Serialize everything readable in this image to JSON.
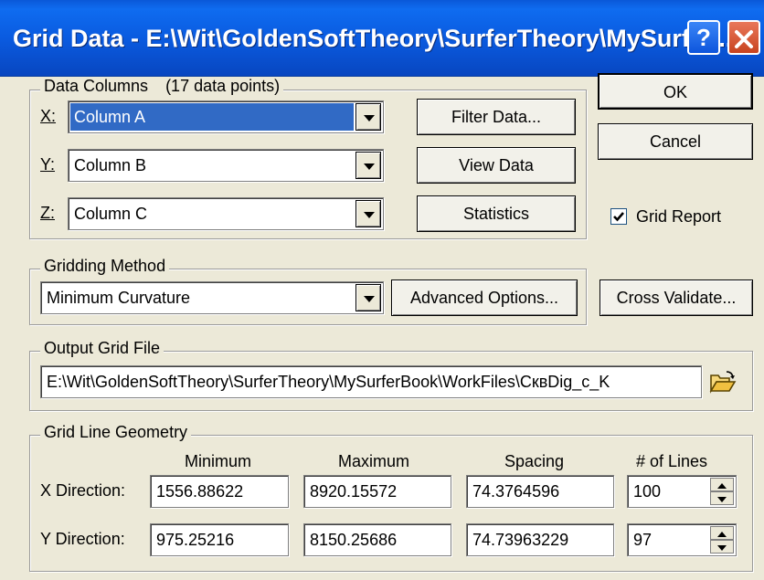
{
  "window": {
    "title": "Grid Data - E:\\Wit\\GoldenSoftTheory\\SurferTheory\\MySurfer...",
    "help_glyph": "?",
    "close_icon": "close-icon"
  },
  "data_columns": {
    "group_label": "Data Columns",
    "point_count": "(17 data points)",
    "x_label": "X:",
    "y_label": "Y:",
    "z_label": "Z:",
    "x_value": "Column A",
    "y_value": "Column B",
    "z_value": "Column C",
    "filter_button": "Filter Data...",
    "view_button": "View Data",
    "statistics_button": "Statistics"
  },
  "dialog_buttons": {
    "ok": "OK",
    "cancel": "Cancel",
    "cross_validate": "Cross Validate..."
  },
  "grid_report": {
    "label": "Grid Report",
    "checked": true
  },
  "gridding_method": {
    "group_label": "Gridding Method",
    "value": "Minimum Curvature",
    "advanced_button": "Advanced Options..."
  },
  "output_grid_file": {
    "group_label": "Output Grid File",
    "value": "E:\\Wit\\GoldenSoftTheory\\SurferTheory\\MySurferBook\\WorkFiles\\СквDig_c_K",
    "browse_icon": "folder-open-icon"
  },
  "grid_line_geometry": {
    "group_label": "Grid Line Geometry",
    "headers": {
      "minimum": "Minimum",
      "maximum": "Maximum",
      "spacing": "Spacing",
      "lines": "# of Lines"
    },
    "x": {
      "label": "X Direction:",
      "minimum": "1556.88622",
      "maximum": "8920.15572",
      "spacing": "74.3764596",
      "lines": "100"
    },
    "y": {
      "label": "Y Direction:",
      "minimum": "975.25216",
      "maximum": "8150.25686",
      "spacing": "74.73963229",
      "lines": "97"
    }
  }
}
